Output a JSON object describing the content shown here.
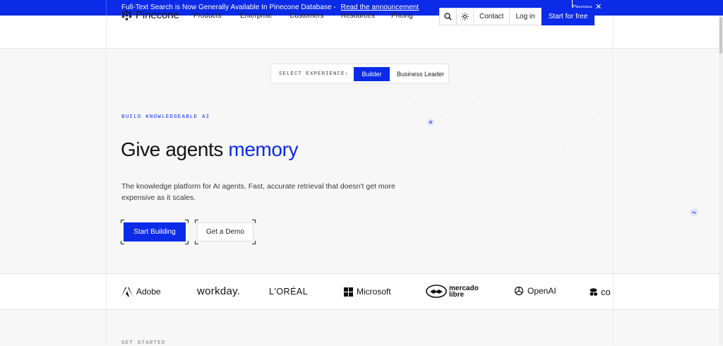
{
  "announcement": {
    "text": "Full-Text Search is Now Generally Available In Pinecone Database -",
    "link": "Read the announcement",
    "dismiss": "Dismiss"
  },
  "header": {
    "logo": "Pinecone",
    "nav": [
      "Products",
      "Enterprise",
      "Customers",
      "Resources",
      "Pricing"
    ],
    "contact": "Contact",
    "login": "Log in",
    "cta": "Start for free"
  },
  "experience": {
    "label": "SELECT EXPERIENCE:",
    "options": [
      "Builder",
      "Business Leader"
    ],
    "selected": "Builder"
  },
  "hero": {
    "eyebrow": "BUILD KNOWLEDGEABLE AI",
    "headline_start": "Give agents ",
    "headline_accent": "memory",
    "description": "The knowledge platform for AI agents. Fast, accurate retrieval that doesn't get more expensive as it scales.",
    "primary_button": "Start Building",
    "secondary_button": "Get a Demo"
  },
  "logos": [
    "Adobe",
    "workday.",
    "L'ORÉAL",
    "Microsoft",
    "mercado libre",
    "OpenAI",
    "co"
  ],
  "next_section": "GET STARTED",
  "colors": {
    "accent": "#0b2be8",
    "background": "#f7f7f8"
  }
}
